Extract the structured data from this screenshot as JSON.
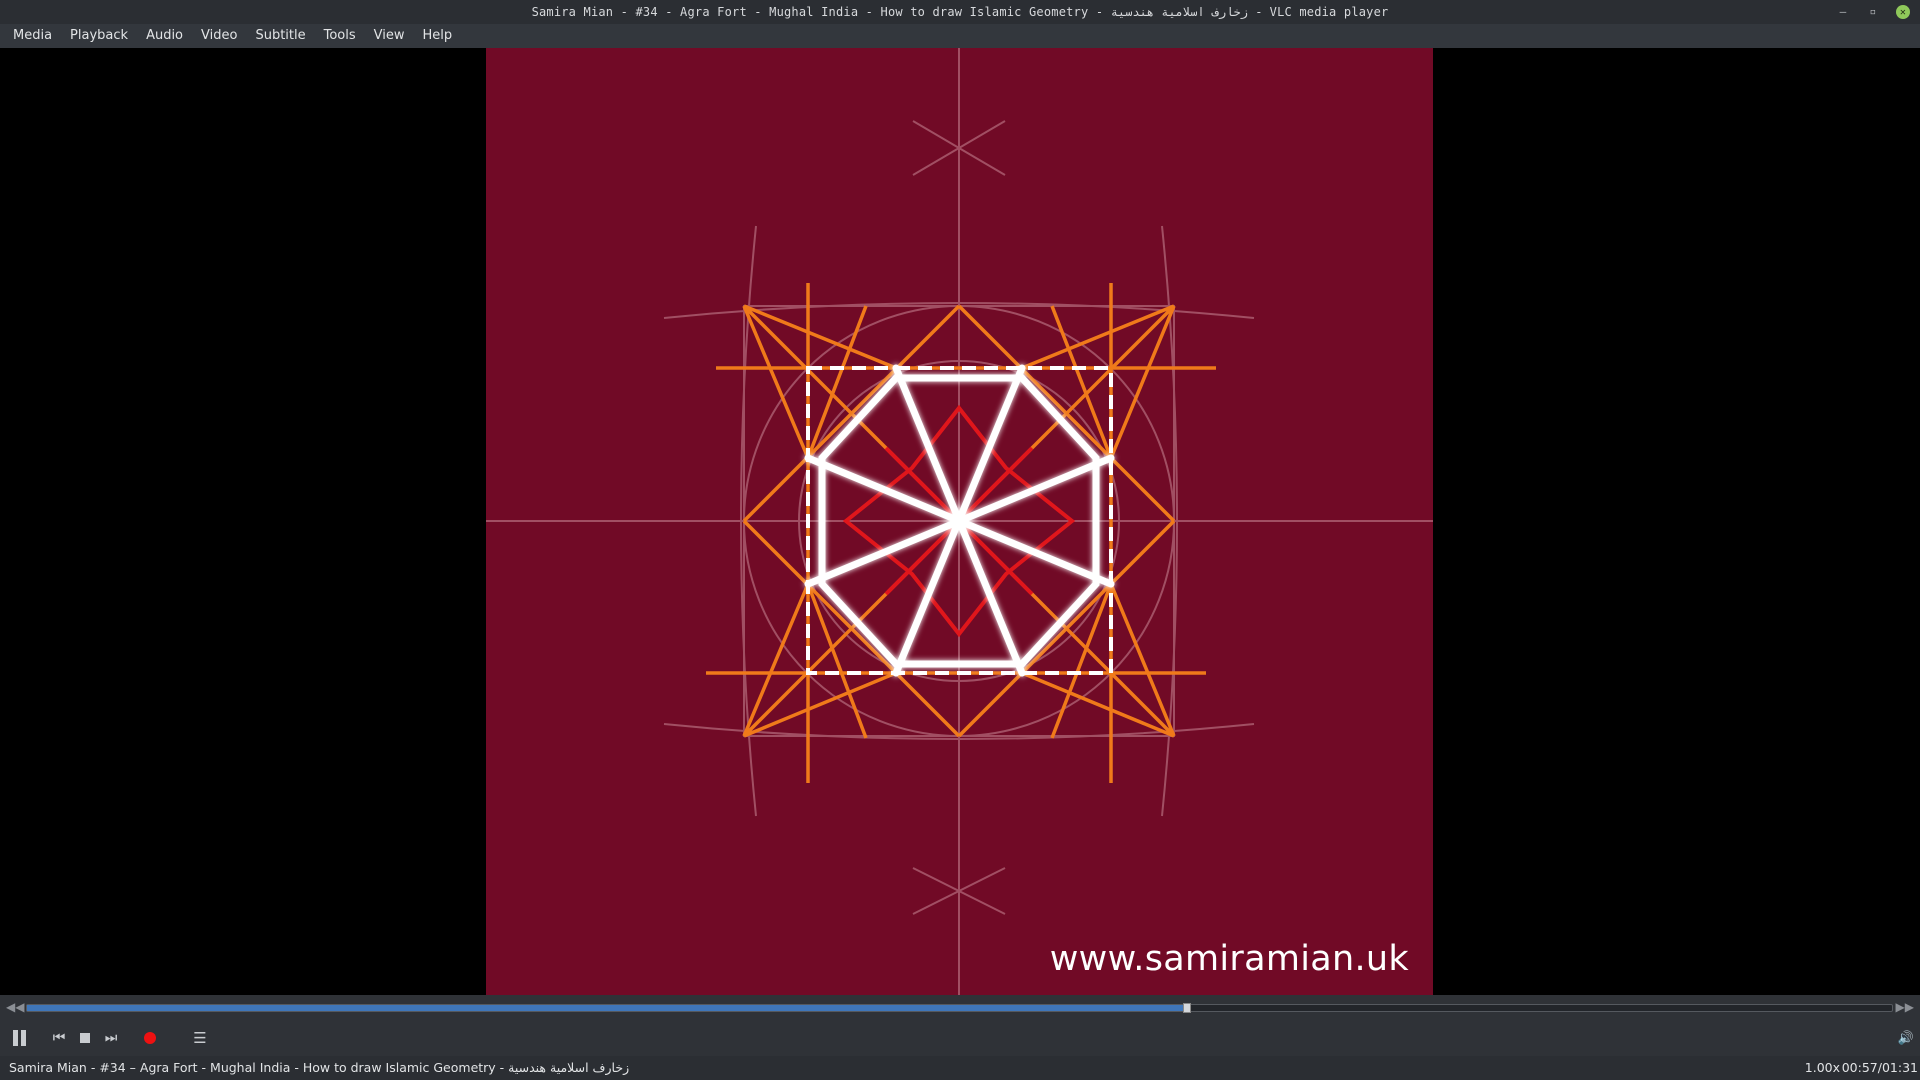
{
  "window": {
    "title": "Samira Mian - #34 - Agra Fort - Mughal India - How to draw Islamic Geometry - زخارف اسلامية هندسية - VLC media player",
    "minimize_glyph": "–",
    "maximize_glyph": "▫",
    "close_glyph": "✕"
  },
  "menu": {
    "items": [
      "Media",
      "Playback",
      "Audio",
      "Video",
      "Subtitle",
      "Tools",
      "View",
      "Help"
    ]
  },
  "video": {
    "watermark": "www.samiramian.uk",
    "background_color": "#710a26"
  },
  "playback": {
    "progress_fraction": 0.622,
    "rewind_glyph": "◀◀",
    "forward_glyph": "▶▶",
    "state": "playing"
  },
  "controls": {
    "icons": [
      "pause-icon",
      "previous-icon",
      "stop-icon",
      "next-icon",
      "record-icon",
      "playlist-icon",
      "volume-icon"
    ],
    "prev_glyph": "⏮",
    "next_glyph": "⏭",
    "playlist_glyph": "☰",
    "volume_glyph": "🔊"
  },
  "status": {
    "title": "Samira Mian - #34 – Agra Fort - Mughal India - How to draw Islamic Geometry - زخارف اسلامية هندسية",
    "speed": "1.00x",
    "time": "00:57/01:31"
  },
  "colors": {
    "accent": "#3f76b9",
    "record": "#ee1111",
    "pattern_orange": "#f07a1a",
    "pattern_red": "#e0161b",
    "pattern_white": "#ffffff"
  }
}
